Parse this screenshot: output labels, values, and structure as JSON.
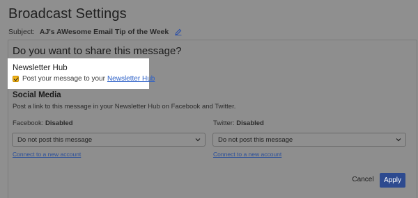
{
  "header": {
    "title": "Broadcast Settings",
    "subject_label": "Subject:",
    "subject_value": "AJ's AWesome Email Tip of the Week",
    "edit_icon": "pencil-icon"
  },
  "share": {
    "heading": "Do you want to share this message?"
  },
  "newsletter_hub": {
    "title": "Newsletter Hub",
    "checkbox_checked": true,
    "checkbox_label": "Post your message to your",
    "link_text": "Newsletter Hub"
  },
  "social_media": {
    "title": "Social Media",
    "description": "Post a link to this message in your Newsletter Hub on Facebook and Twitter.",
    "facebook": {
      "label": "Facebook:",
      "status": "Disabled",
      "selected": "Do not post this message",
      "connect_link": "Connect to a new account"
    },
    "twitter": {
      "label": "Twitter:",
      "status": "Disabled",
      "selected": "Do not post this message",
      "connect_link": "Connect to a new account"
    }
  },
  "actions": {
    "cancel": "Cancel",
    "apply": "Apply"
  },
  "colors": {
    "overlay_bg": "#8f8f8f",
    "link": "#2b5fc7",
    "apply_button": "#2d4a8f",
    "checkbox": "#f3b51b",
    "highlight": "#ffffff"
  }
}
